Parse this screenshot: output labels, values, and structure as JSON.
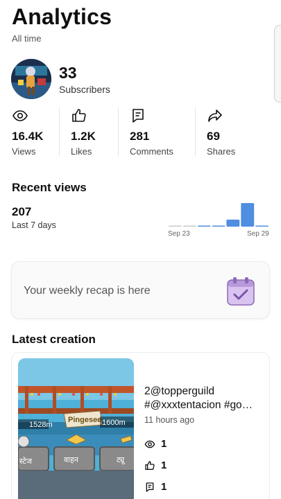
{
  "header": {
    "title": "Analytics",
    "subtitle": "All time"
  },
  "channel": {
    "subscribers_count": "33",
    "subscribers_label": "Subscribers"
  },
  "stats": [
    {
      "icon": "eye-icon",
      "value": "16.4K",
      "label": "Views"
    },
    {
      "icon": "thumbs-up-icon",
      "value": "1.2K",
      "label": "Likes"
    },
    {
      "icon": "comment-icon",
      "value": "281",
      "label": "Comments"
    },
    {
      "icon": "share-icon",
      "value": "69",
      "label": "Shares"
    }
  ],
  "recent_views": {
    "title": "Recent views",
    "count": "207",
    "period": "Last 7 days",
    "x_start_label": "Sep 23",
    "x_end_label": "Sep 29"
  },
  "chart_data": {
    "type": "bar",
    "categories": [
      "Sep 23",
      "Sep 24",
      "Sep 25",
      "Sep 26",
      "Sep 27",
      "Sep 28",
      "Sep 29"
    ],
    "values": [
      2,
      2,
      3,
      6,
      40,
      135,
      5
    ],
    "bar_color": "#4f8ee0",
    "zero_bar_color": "#c8c8c8"
  },
  "recap": {
    "text": "Your weekly recap is here",
    "icon": "calendar-check-icon"
  },
  "latest": {
    "title": "Latest creation",
    "video_title_line1": "2@topperguild",
    "video_title_line2": "#@xxxtentacion #go…",
    "time": "11 hours ago",
    "views": "1",
    "likes": "1",
    "comments": "1",
    "thumbnail_text": {
      "left_distance": "1528m",
      "right_distance": "1600m",
      "sign": "Pingesee",
      "tab1": "स्टेज",
      "tab2": "वाहन",
      "tab3": "ट्यू"
    }
  }
}
